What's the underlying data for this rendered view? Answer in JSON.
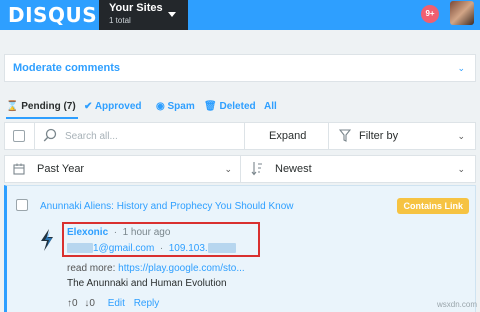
{
  "topbar": {
    "logo": "DISQUS",
    "sites_title": "Your Sites",
    "sites_sub": "1 total",
    "notifications": "9+"
  },
  "moderate": {
    "label": "Moderate comments"
  },
  "tabs": {
    "pending": "Pending (7)",
    "approved": "Approved",
    "spam": "Spam",
    "deleted": "Deleted",
    "all": "All"
  },
  "toolbar": {
    "search_placeholder": "Search all...",
    "expand": "Expand",
    "filter": "Filter by",
    "period": "Past Year",
    "sort": "Newest"
  },
  "comment": {
    "thread_title": "Anunnaki Aliens: History and Prophecy You Should Know",
    "badge": "Contains Link",
    "author": "Elexonic",
    "time": "1 hour ago",
    "email": "1@gmail.com",
    "ip": "109.103.",
    "readmore_label": "read more:",
    "readmore_link": "https://play.google.com/sto...",
    "body": "The Anunnaki and Human Evolution",
    "upvotes": "0",
    "downvotes": "0",
    "edit": "Edit",
    "reply": "Reply"
  },
  "watermark": "wsxdn.com",
  "colors": {
    "brand": "#2e9fff",
    "dark": "#23272b",
    "badge": "#f6c342",
    "highlight": "#d9302f"
  }
}
